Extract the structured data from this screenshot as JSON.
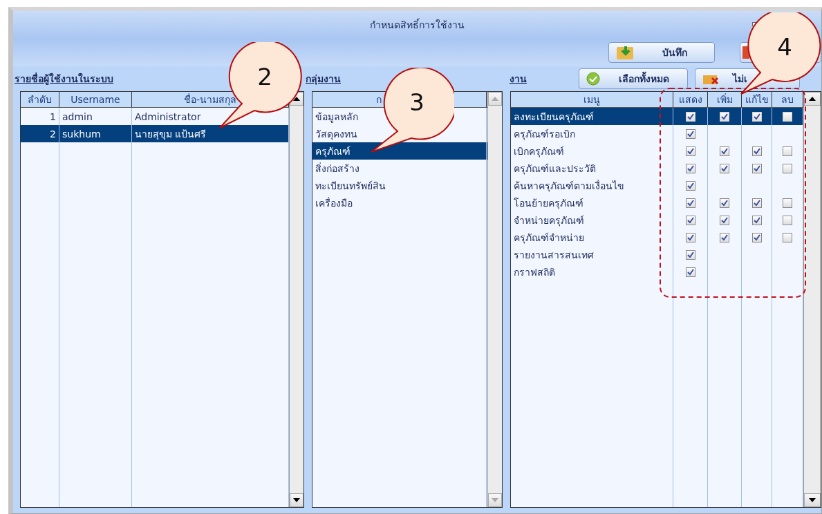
{
  "window": {
    "title": "กำหนดสิทธิ์การใช้งาน"
  },
  "toolbar": {
    "save_button": "บันทึก"
  },
  "users": {
    "heading": "รายชื่อผู้ใช้งานในระบบ",
    "columns": [
      "ลำดับ",
      "Username",
      "ชื่อ-นามสกุล"
    ],
    "rows": [
      {
        "no": "1",
        "username": "admin",
        "name": "Administrator",
        "selected": false
      },
      {
        "no": "2",
        "username": "sukhum",
        "name": "นายสุขุม  แป้นศรี",
        "selected": true
      }
    ]
  },
  "groups": {
    "heading": "กลุ่มงาน",
    "column": "ก",
    "rows": [
      {
        "name": "ข้อมูลหลัก",
        "selected": false
      },
      {
        "name": "วัสดุคงทน",
        "selected": false
      },
      {
        "name": "ครุภัณฑ์",
        "selected": true
      },
      {
        "name": "สิ่งก่อสร้าง",
        "selected": false
      },
      {
        "name": "ทะเบียนทรัพย์สิน",
        "selected": false
      },
      {
        "name": "เครื่องมือ",
        "selected": false
      }
    ]
  },
  "tasks": {
    "heading": "งาน",
    "select_all_button": "เลือกทั้งหมด",
    "select_none_button": "ไม่เ",
    "columns": [
      "เมนู",
      "แสดง",
      "เพิ่ม",
      "แก้ไข",
      "ลบ"
    ],
    "rows": [
      {
        "name": "ลงทะเบียนครุภัณฑ์",
        "selected": true,
        "perms": [
          {
            "checked": true
          },
          {
            "checked": true
          },
          {
            "checked": true
          },
          {
            "checked": false
          }
        ]
      },
      {
        "name": "ครุภัณฑ์รอเบิก",
        "selected": false,
        "perms": [
          {
            "checked": true
          },
          {
            "kind": "blank"
          },
          {
            "kind": "blank"
          },
          {
            "kind": "blank"
          }
        ]
      },
      {
        "name": "เบิกครุภัณฑ์",
        "selected": false,
        "perms": [
          {
            "checked": true
          },
          {
            "checked": true
          },
          {
            "checked": true
          },
          {
            "checked": false
          }
        ]
      },
      {
        "name": "ครุภัณฑ์และประวัติ",
        "selected": false,
        "perms": [
          {
            "checked": true
          },
          {
            "checked": true
          },
          {
            "checked": true
          },
          {
            "checked": false
          }
        ]
      },
      {
        "name": "ค้นหาครุภัณฑ์ตามเงื่อนไข",
        "selected": false,
        "perms": [
          {
            "checked": true
          },
          {
            "kind": "blank"
          },
          {
            "kind": "blank"
          },
          {
            "kind": "blank"
          }
        ]
      },
      {
        "name": "โอนย้ายครุภัณฑ์",
        "selected": false,
        "perms": [
          {
            "checked": true
          },
          {
            "checked": true
          },
          {
            "checked": true
          },
          {
            "checked": false
          }
        ]
      },
      {
        "name": "จำหน่ายครุภัณฑ์",
        "selected": false,
        "perms": [
          {
            "checked": true
          },
          {
            "checked": true
          },
          {
            "checked": true
          },
          {
            "checked": false
          }
        ]
      },
      {
        "name": "ครุภัณฑ์จำหน่าย",
        "selected": false,
        "perms": [
          {
            "checked": true
          },
          {
            "checked": true
          },
          {
            "checked": true
          },
          {
            "checked": false
          }
        ]
      },
      {
        "name": "รายงานสารสนเทศ",
        "selected": false,
        "perms": [
          {
            "checked": true
          },
          {
            "kind": "blank"
          },
          {
            "kind": "blank"
          },
          {
            "kind": "blank"
          }
        ]
      },
      {
        "name": "กราฟสถิติ",
        "selected": false,
        "perms": [
          {
            "checked": true
          },
          {
            "kind": "blank"
          },
          {
            "kind": "blank"
          },
          {
            "kind": "blank"
          }
        ]
      }
    ]
  },
  "callouts": [
    "2",
    "3",
    "4"
  ]
}
